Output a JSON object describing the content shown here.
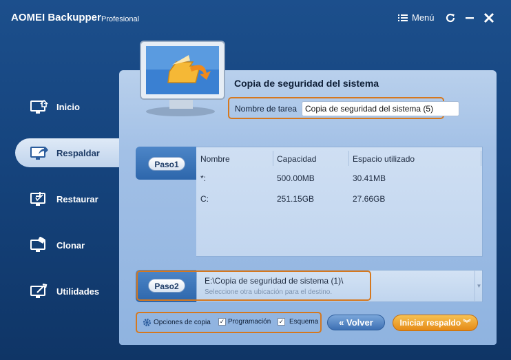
{
  "app": {
    "title": "AOMEI Backupper",
    "edition": "Profesional"
  },
  "titlebar": {
    "menu_label": "Menú"
  },
  "nav": {
    "items": [
      {
        "label": "Inicio"
      },
      {
        "label": "Respaldar"
      },
      {
        "label": "Restaurar"
      },
      {
        "label": "Clonar"
      },
      {
        "label": "Utilidades"
      }
    ],
    "active": "Respaldar"
  },
  "main": {
    "title": "Copia de seguridad del sistema",
    "task_label": "Nombre de tarea",
    "task_value": "Copia de seguridad del sistema (5)"
  },
  "step1": {
    "label": "Paso1",
    "columns": [
      "Nombre",
      "Capacidad",
      "Espacio utilizado"
    ],
    "rows": [
      [
        "*:",
        "500.00MB",
        "30.41MB"
      ],
      [
        "C:",
        "251.15GB",
        "27.66GB"
      ]
    ]
  },
  "step2": {
    "label": "Paso2",
    "path": "E:\\Copia de seguridad de sistema (1)\\",
    "hint": "Seleccione otra ubicación para el destino."
  },
  "footer": {
    "options_label": "Opciones de copia",
    "schedule_label": "Programación",
    "schedule_checked": true,
    "scheme_label": "Esquema",
    "scheme_checked": true,
    "back_label": "Volver",
    "start_label": "Iniciar respaldo"
  },
  "colors": {
    "accent_orange": "#d5781f",
    "panel_blue": "#a2c0e6",
    "app_blue": "#1c4f8c"
  }
}
